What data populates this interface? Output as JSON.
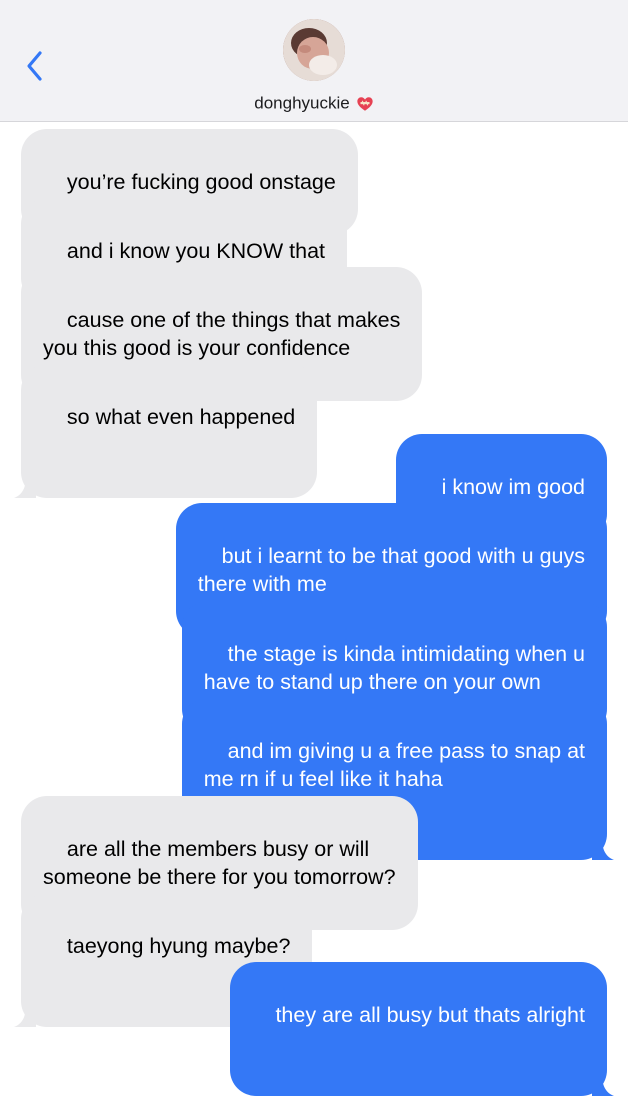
{
  "header": {
    "contact_name": "donghyuckie",
    "back_icon": "chevron-left-icon",
    "status_emoji": "mending-heart-icon",
    "accent_color": "#3478f6"
  },
  "messages": [
    {
      "from": "them",
      "text": "you’re fucking good onstage"
    },
    {
      "from": "them",
      "text": "and i know you KNOW that"
    },
    {
      "from": "them",
      "text": "cause one of the things that makes\nyou this good is your confidence"
    },
    {
      "from": "them",
      "text": "so what even happened"
    },
    {
      "from": "me",
      "text": "i know im good"
    },
    {
      "from": "me",
      "text": "but i learnt to be that good with u guys\nthere with me"
    },
    {
      "from": "me",
      "text": "the stage is kinda intimidating when u\nhave to stand up there on your own"
    },
    {
      "from": "me",
      "text": "and im giving u a free pass to snap at\nme rn if u feel like it haha"
    },
    {
      "from": "them",
      "text": "are all the members busy or will\nsomeone be there for you tomorrow?"
    },
    {
      "from": "them",
      "text": "taeyong hyung maybe?"
    },
    {
      "from": "me",
      "text": "they are all busy but thats alright"
    }
  ]
}
